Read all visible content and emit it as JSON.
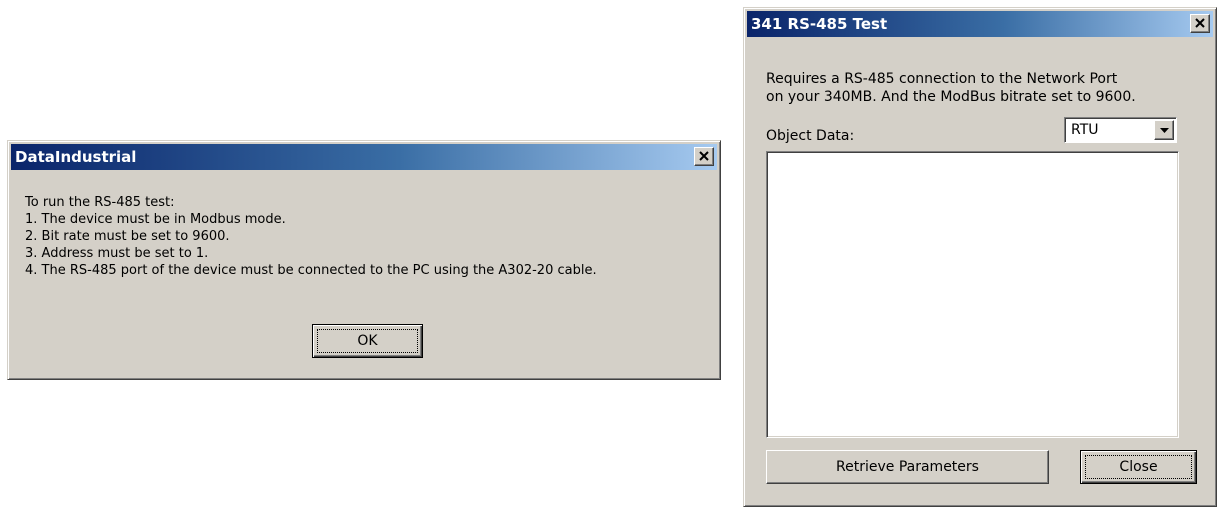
{
  "dialog_left": {
    "title": "DataIndustrial",
    "message_lines": [
      "To run the RS-485 test:",
      "1. The device must be in Modbus mode.",
      "2. Bit rate must be set to 9600.",
      "3. Address must be set to 1.",
      "4. The RS-485 port of the device must be connected to the PC using the A302-20 cable."
    ],
    "ok_label": "OK"
  },
  "dialog_right": {
    "title": "341 RS-485 Test",
    "requirement_lines": [
      "Requires a RS-485 connection to the Network Port",
      "on your 340MB. And the ModBus bitrate set to 9600."
    ],
    "object_data_label": "Object Data:",
    "mode_select": {
      "value": "RTU"
    },
    "object_data_text": "",
    "retrieve_label": "Retrieve Parameters",
    "close_label": "Close"
  }
}
